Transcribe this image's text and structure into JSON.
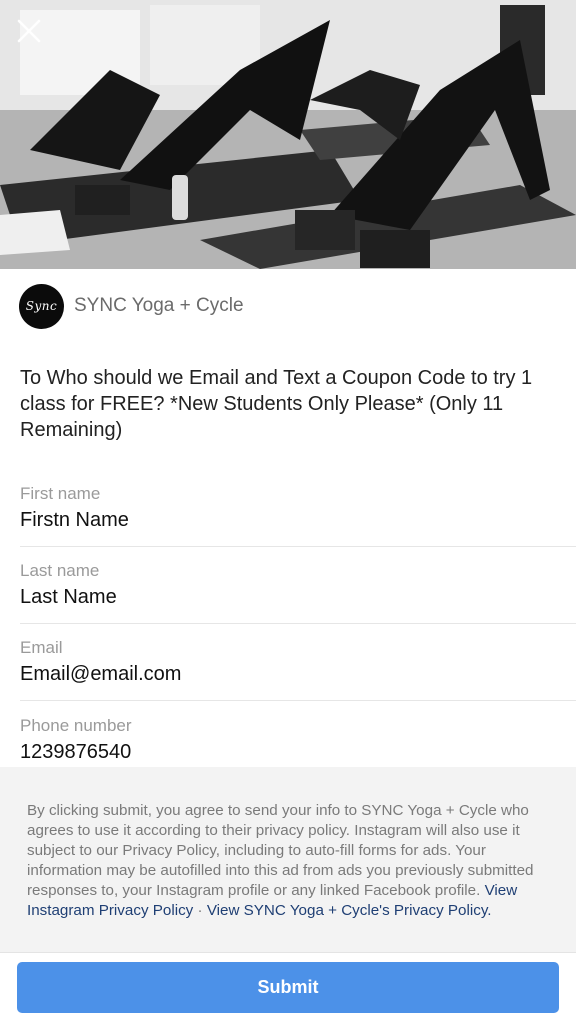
{
  "header": {
    "close_icon": "close-icon",
    "image_icon": "photo-yoga-class"
  },
  "brand": {
    "avatar_text": "Sync",
    "name": "SYNC Yoga + Cycle"
  },
  "question": "To Who should we Email and Text a Coupon Code to try 1 class for FREE?  *New Students Only Please* (Only 11 Remaining)",
  "fields": [
    {
      "label": "First name",
      "value": "Firstn Name"
    },
    {
      "label": "Last name",
      "value": "Last Name"
    },
    {
      "label": "Email",
      "value": "Email@email.com"
    },
    {
      "label": "Phone number",
      "value": "1239876540"
    }
  ],
  "disclaimer": {
    "text": "By clicking submit, you agree to send your info to SYNC Yoga + Cycle who agrees to use it according to their privacy policy. Instagram will also use it subject to our Privacy Policy, including to auto-fill forms for ads. Your information may be autofilled into this ad from ads you previously submitted responses to, your Instagram profile or any linked Facebook profile.",
    "link_instagram": "View Instagram Privacy Policy",
    "separator": "·",
    "link_advertiser": "View SYNC Yoga + Cycle's Privacy Policy."
  },
  "footer": {
    "submit_label": "Submit"
  },
  "colors": {
    "accent": "#4c91e8",
    "link": "#1f3f74"
  }
}
